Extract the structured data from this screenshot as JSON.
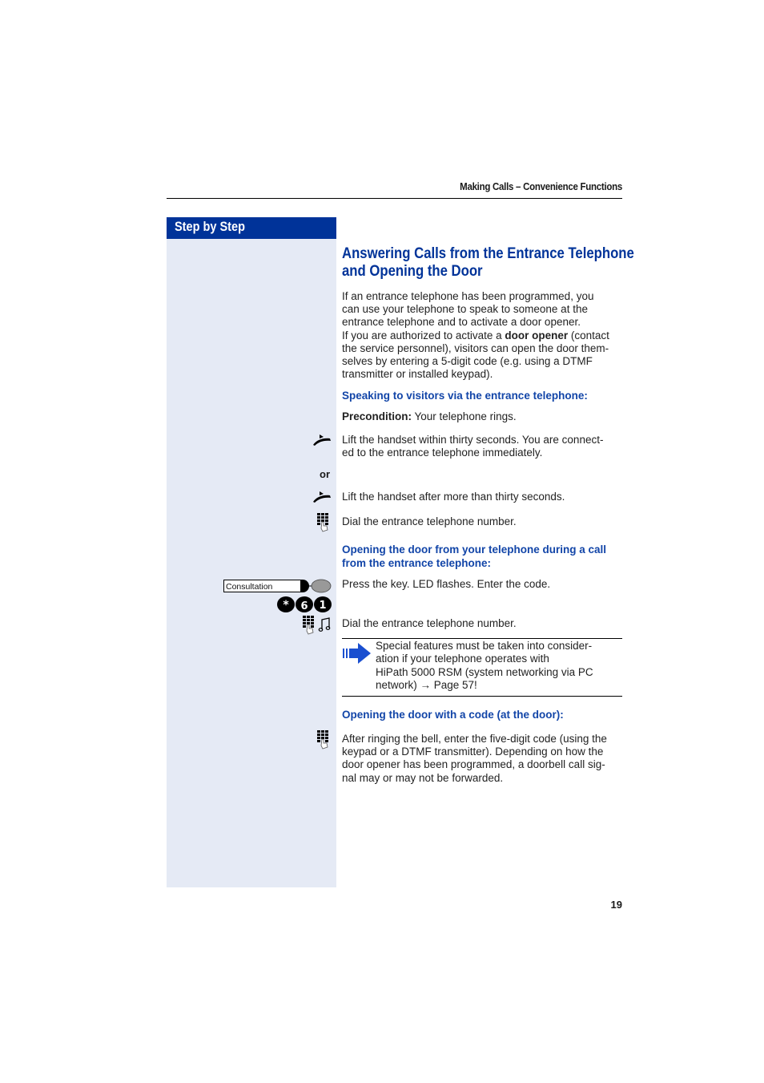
{
  "header": {
    "running_head": "Making Calls – Convenience Functions"
  },
  "sidebar": {
    "title": "Step by Step"
  },
  "section": {
    "title_line1": "Answering Calls from the Entrance Telephone",
    "title_line2": "and Opening the Door",
    "intro": {
      "line1": "If an entrance telephone has been programmed, you",
      "line2": "can use your telephone to speak to someone at the",
      "line3": "entrance telephone and to activate a door opener.",
      "line4_pre": "If you are authorized to activate a ",
      "line4_bold": "door opener",
      "line4_post": " (contact",
      "line5": "the service personnel), visitors can open the door them-",
      "line6": "selves by entering a 5-digit code (e.g. using a DTMF",
      "line7": "transmitter or installed keypad)."
    }
  },
  "speaking": {
    "heading": "Speaking to visitors via the entrance telephone:",
    "precondition_label": "Precondition:",
    "precondition_text": " Your telephone rings.",
    "step1_line1": "Lift the handset within thirty seconds. You are connect-",
    "step1_line2": "ed to the entrance telephone immediately.",
    "or_label": "or",
    "step2": "Lift the handset after more than thirty seconds.",
    "step3": "Dial the entrance telephone number."
  },
  "opening_call": {
    "heading_line1": "Opening the door from your telephone during a call",
    "heading_line2": "from the entrance telephone:",
    "key_label": "Consultation",
    "step1": "Press the key. LED flashes. Enter the code.",
    "code_keys": [
      "*",
      "6",
      "1"
    ],
    "step2": "Dial the entrance telephone number."
  },
  "note": {
    "line1": "Special features must be taken into consider-",
    "line2": "ation if your telephone operates with",
    "line3": "HiPath 5000 RSM (system networking via PC",
    "line4": "network) → Page 57!"
  },
  "opening_code": {
    "heading": "Opening the door with a code (at the door):",
    "line1": "After ringing the bell, enter the five-digit code (using the",
    "line2": "keypad or a DTMF transmitter). Depending on how the",
    "line3": "door opener has been programmed, a doorbell call sig-",
    "line4": "nal may or may not be forwarded."
  },
  "footer": {
    "page_number": "19"
  },
  "colors": {
    "brand_blue": "#003399",
    "sidebar_bg": "#e5eaf5",
    "heading_blue": "#1245a8"
  }
}
